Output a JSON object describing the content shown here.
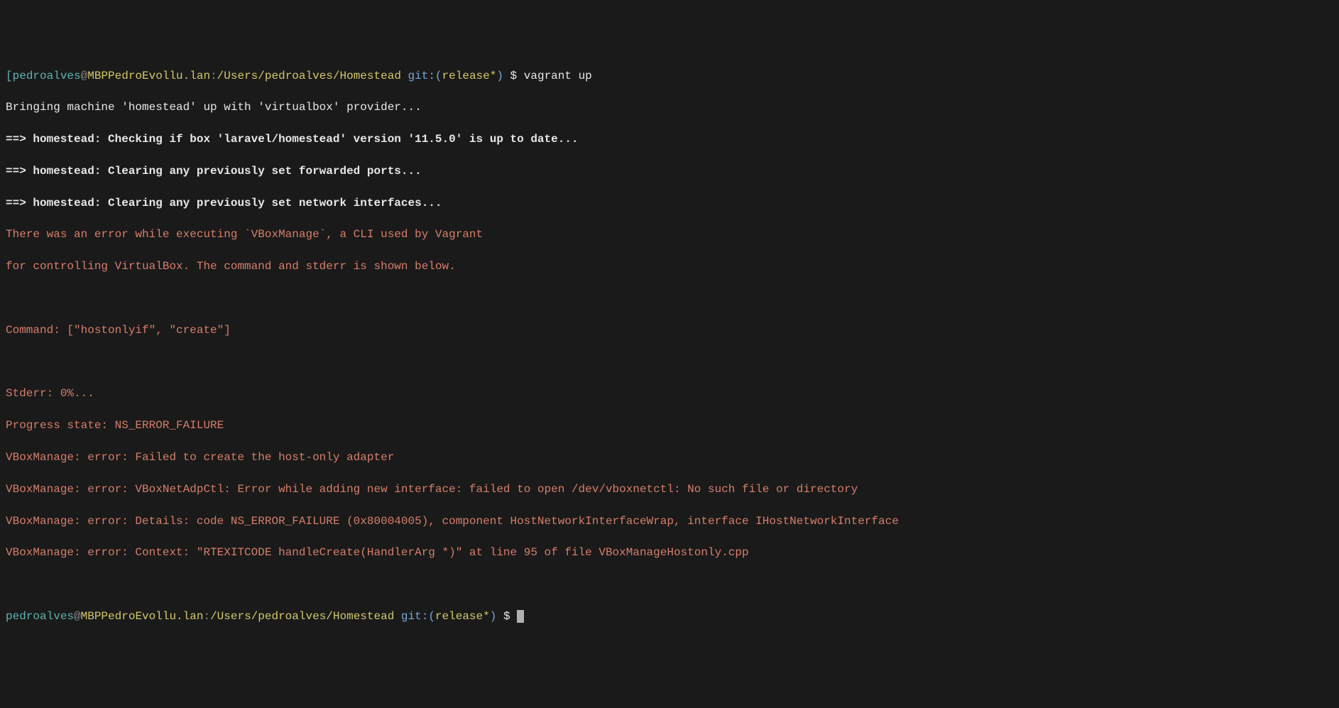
{
  "prompt1": {
    "bracket_open": "[",
    "user": "pedroalves",
    "at": "@",
    "host": "MBPPedroEvollu.lan",
    "colon": ":",
    "path": "/Users/pedroalves/Homestead",
    "git_label": " git:(",
    "git_branch": "release*",
    "git_close": ")",
    "dollar": " $ ",
    "command": "vagrant up"
  },
  "output": {
    "line1": "Bringing machine 'homestead' up with 'virtualbox' provider...",
    "line2": "==> homestead: Checking if box 'laravel/homestead' version '11.5.0' is up to date...",
    "line3": "==> homestead: Clearing any previously set forwarded ports...",
    "line4": "==> homestead: Clearing any previously set network interfaces...",
    "err1": "There was an error while executing `VBoxManage`, a CLI used by Vagrant",
    "err2": "for controlling VirtualBox. The command and stderr is shown below.",
    "blank1": "",
    "err3": "Command: [\"hostonlyif\", \"create\"]",
    "blank2": "",
    "err4": "Stderr: 0%...",
    "err5": "Progress state: NS_ERROR_FAILURE",
    "err6": "VBoxManage: error: Failed to create the host-only adapter",
    "err7": "VBoxManage: error: VBoxNetAdpCtl: Error while adding new interface: failed to open /dev/vboxnetctl: No such file or directory",
    "err8": "VBoxManage: error: Details: code NS_ERROR_FAILURE (0x80004005), component HostNetworkInterfaceWrap, interface IHostNetworkInterface",
    "err9": "VBoxManage: error: Context: \"RTEXITCODE handleCreate(HandlerArg *)\" at line 95 of file VBoxManageHostonly.cpp",
    "blank3": ""
  },
  "prompt2": {
    "user": "pedroalves",
    "at": "@",
    "host": "MBPPedroEvollu.lan",
    "colon": ":",
    "path": "/Users/pedroalves/Homestead",
    "git_label": " git:(",
    "git_branch": "release*",
    "git_close": ")",
    "dollar": " $ "
  }
}
